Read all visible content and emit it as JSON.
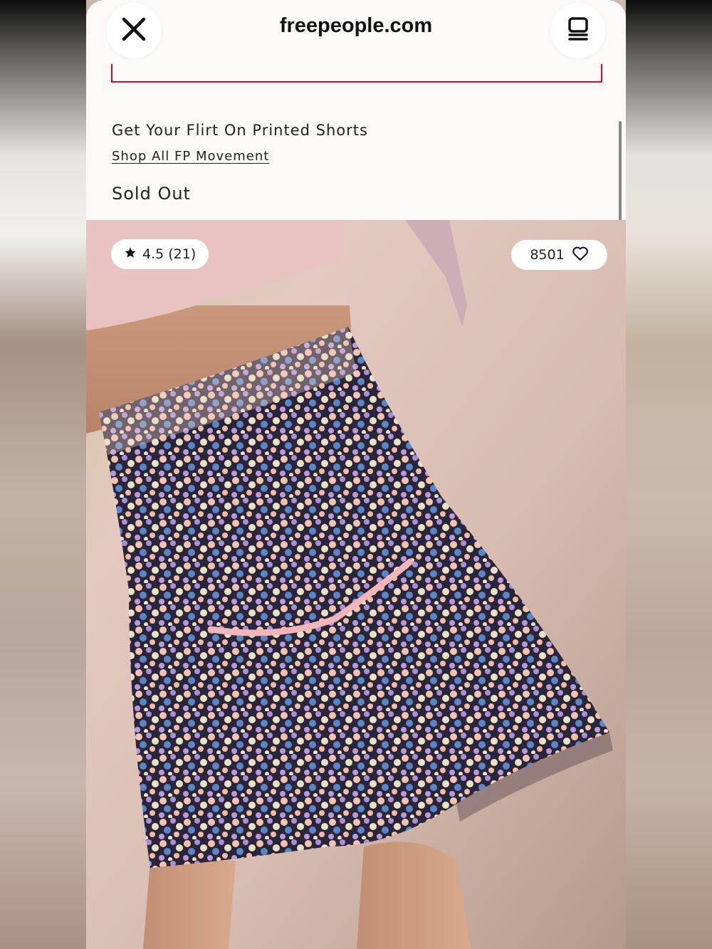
{
  "browser": {
    "site": "freepeople.com"
  },
  "product": {
    "title": "Get Your Flirt On Printed Shorts",
    "collection_link": "Shop All FP Movement",
    "availability": "Sold Out"
  },
  "badges": {
    "rating": "4.5 (21)",
    "likes": "8501"
  },
  "icons": {
    "close": "close-icon",
    "tabs": "tabs-icon",
    "star": "star-icon",
    "heart": "heart-icon"
  },
  "colors": {
    "accent_red": "#c8102e",
    "page_bg": "#fdf9f8",
    "text": "#222222"
  }
}
